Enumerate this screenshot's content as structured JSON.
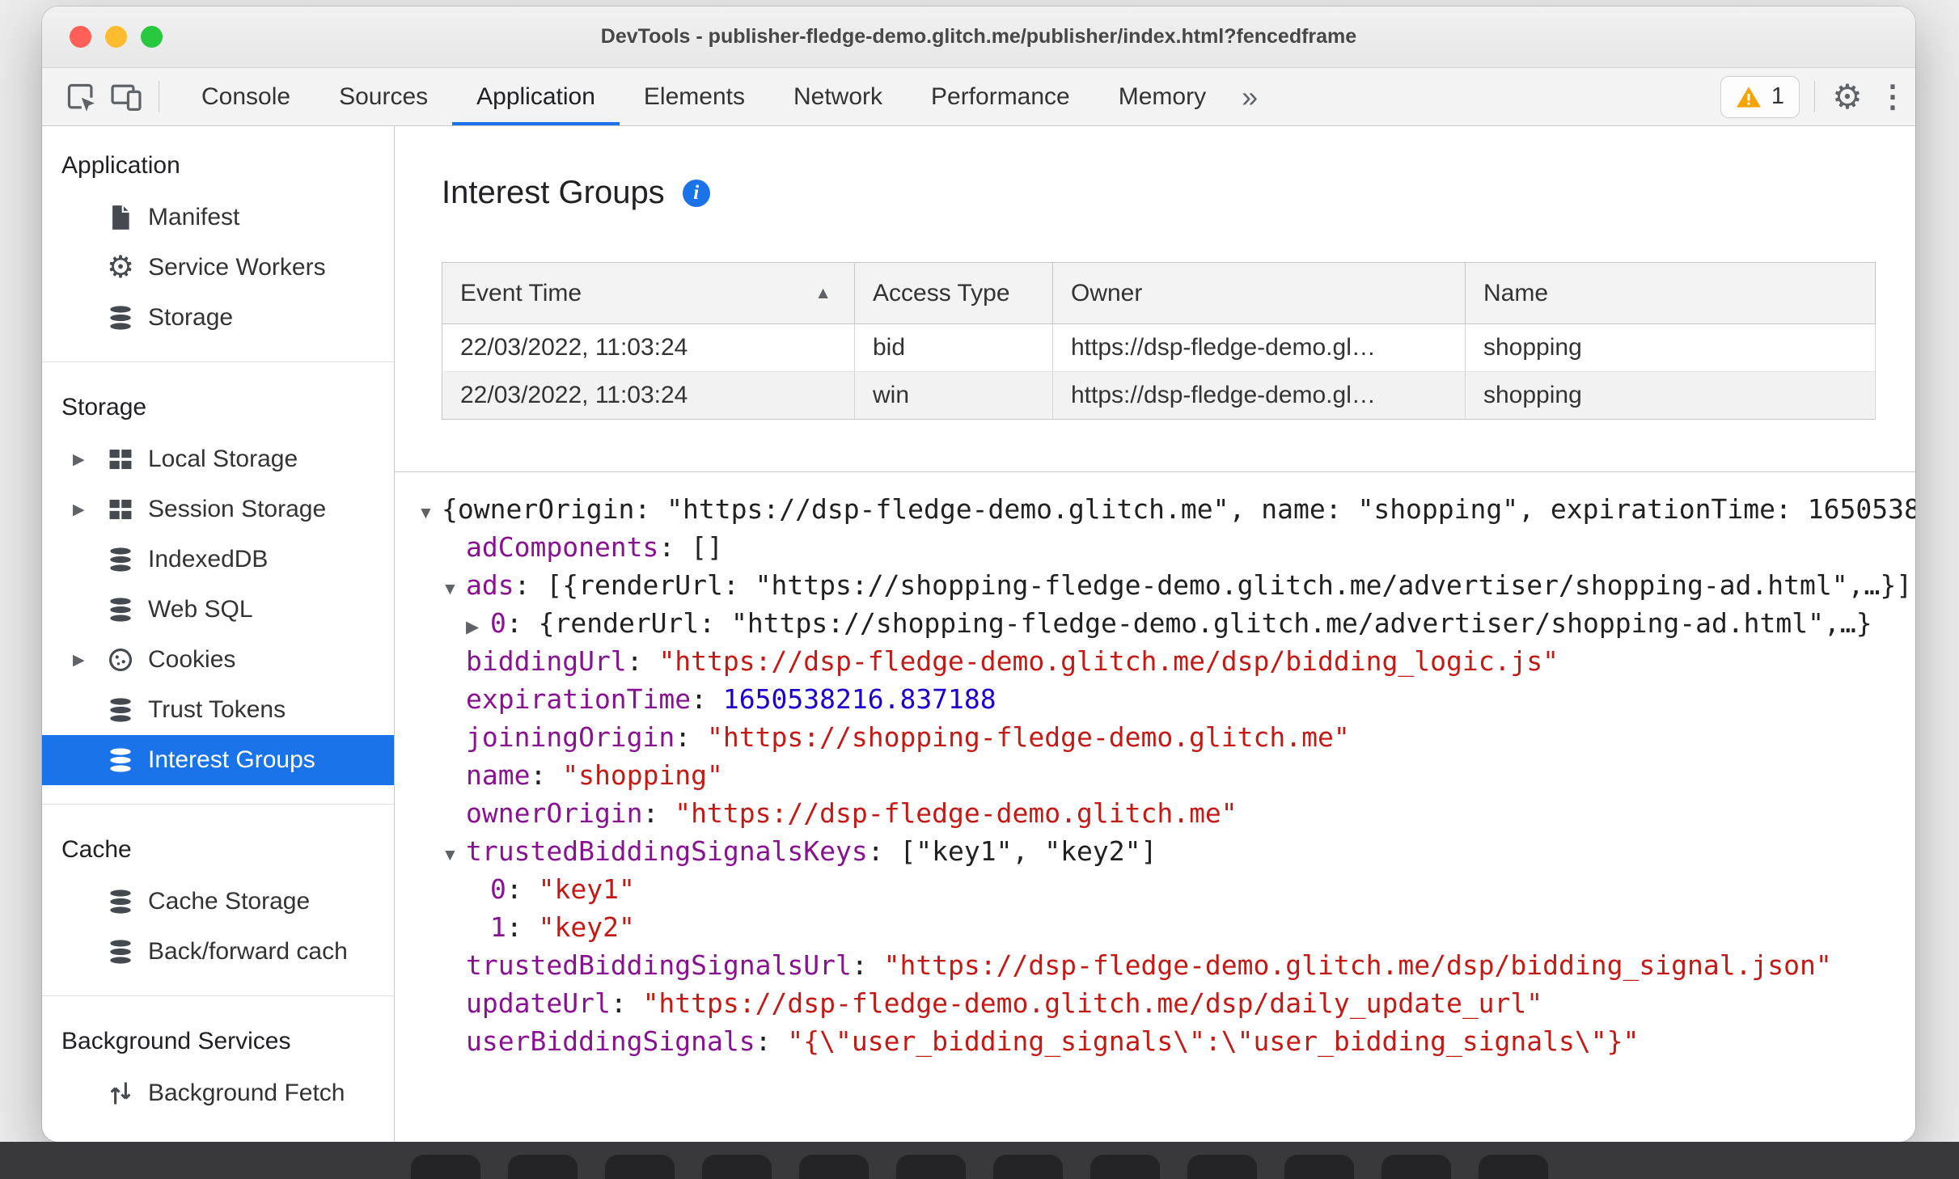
{
  "window": {
    "title": "DevTools - publisher-fledge-demo.glitch.me/publisher/index.html?fencedframe"
  },
  "toolbar": {
    "tabs": [
      {
        "label": "Console",
        "active": false
      },
      {
        "label": "Sources",
        "active": false
      },
      {
        "label": "Application",
        "active": true
      },
      {
        "label": "Elements",
        "active": false
      },
      {
        "label": "Network",
        "active": false
      },
      {
        "label": "Performance",
        "active": false
      },
      {
        "label": "Memory",
        "active": false
      }
    ],
    "warning_count": "1"
  },
  "icons": {
    "gear": "⚙",
    "kebab": "⋮",
    "more_tabs": "»",
    "info": "i",
    "sort_ascending": "▲",
    "arrow_expanded": "▼",
    "arrow_collapsed": "▶",
    "sidebar_expander": "▶"
  },
  "colors": {
    "accent_blue": "#1a73e8",
    "selected_row_blue": "#1a73e8",
    "key_purple": "#881391",
    "string_red": "#c41a16",
    "number_blue": "#1c00cf",
    "warning_orange": "#f5a300"
  },
  "sidebar": {
    "sections": [
      {
        "title": "Application",
        "items": [
          {
            "label": "Manifest",
            "icon": "manifest-file-icon",
            "expander": false,
            "selected": false
          },
          {
            "label": "Service Workers",
            "icon": "service-worker-gear-icon",
            "expander": false,
            "selected": false
          },
          {
            "label": "Storage",
            "icon": "storage-stack-icon",
            "expander": false,
            "selected": false
          }
        ]
      },
      {
        "title": "Storage",
        "items": [
          {
            "label": "Local Storage",
            "icon": "datagrid-icon",
            "expander": true,
            "selected": false
          },
          {
            "label": "Session Storage",
            "icon": "datagrid-icon",
            "expander": true,
            "selected": false
          },
          {
            "label": "IndexedDB",
            "icon": "storage-stack-icon",
            "expander": false,
            "selected": false
          },
          {
            "label": "Web SQL",
            "icon": "storage-stack-icon",
            "expander": false,
            "selected": false
          },
          {
            "label": "Cookies",
            "icon": "cookie-icon",
            "expander": true,
            "selected": false
          },
          {
            "label": "Trust Tokens",
            "icon": "storage-stack-icon",
            "expander": false,
            "selected": false
          },
          {
            "label": "Interest Groups",
            "icon": "storage-stack-icon",
            "expander": false,
            "selected": true
          }
        ]
      },
      {
        "title": "Cache",
        "items": [
          {
            "label": "Cache Storage",
            "icon": "storage-stack-icon",
            "expander": false,
            "selected": false
          },
          {
            "label": "Back/forward cach",
            "icon": "storage-stack-icon",
            "expander": false,
            "selected": false
          }
        ]
      },
      {
        "title": "Background Services",
        "items": [
          {
            "label": "Background Fetch",
            "icon": "fetch-arrows-icon",
            "expander": false,
            "selected": false
          }
        ]
      }
    ]
  },
  "main": {
    "title": "Interest Groups",
    "table": {
      "columns": [
        "Event Time",
        "Access Type",
        "Owner",
        "Name"
      ],
      "sort_column": "Event Time",
      "sort_direction": "ascending",
      "rows": [
        [
          "22/03/2022, 11:03:24",
          "bid",
          "https://dsp-fledge-demo.gl…",
          "shopping"
        ],
        [
          "22/03/2022, 11:03:24",
          "win",
          "https://dsp-fledge-demo.gl…",
          "shopping"
        ]
      ]
    },
    "tree": [
      {
        "indent": 0,
        "arrow": "expanded",
        "tokens": [
          {
            "c": "plain",
            "t": "{ownerOrigin: \"https://dsp-fledge-demo.glitch.me\", name: \"shopping\", expirationTime: 1650538"
          }
        ]
      },
      {
        "indent": 1,
        "arrow": null,
        "tokens": [
          {
            "c": "key",
            "t": "adComponents"
          },
          {
            "c": "plain",
            "t": ": []"
          }
        ]
      },
      {
        "indent": 1,
        "arrow": "expanded",
        "tokens": [
          {
            "c": "key",
            "t": "ads"
          },
          {
            "c": "plain",
            "t": ": [{renderUrl: \"https://shopping-fledge-demo.glitch.me/advertiser/shopping-ad.html\",…}]"
          }
        ]
      },
      {
        "indent": 2,
        "arrow": "collapsed",
        "tokens": [
          {
            "c": "key",
            "t": "0"
          },
          {
            "c": "plain",
            "t": ": {renderUrl: \"https://shopping-fledge-demo.glitch.me/advertiser/shopping-ad.html\",…}"
          }
        ]
      },
      {
        "indent": 1,
        "arrow": null,
        "tokens": [
          {
            "c": "key",
            "t": "biddingUrl"
          },
          {
            "c": "plain",
            "t": ": "
          },
          {
            "c": "string",
            "t": "\"https://dsp-fledge-demo.glitch.me/dsp/bidding_logic.js\""
          }
        ]
      },
      {
        "indent": 1,
        "arrow": null,
        "tokens": [
          {
            "c": "key",
            "t": "expirationTime"
          },
          {
            "c": "plain",
            "t": ": "
          },
          {
            "c": "number",
            "t": "1650538216.837188"
          }
        ]
      },
      {
        "indent": 1,
        "arrow": null,
        "tokens": [
          {
            "c": "key",
            "t": "joiningOrigin"
          },
          {
            "c": "plain",
            "t": ": "
          },
          {
            "c": "string",
            "t": "\"https://shopping-fledge-demo.glitch.me\""
          }
        ]
      },
      {
        "indent": 1,
        "arrow": null,
        "tokens": [
          {
            "c": "key",
            "t": "name"
          },
          {
            "c": "plain",
            "t": ": "
          },
          {
            "c": "string",
            "t": "\"shopping\""
          }
        ]
      },
      {
        "indent": 1,
        "arrow": null,
        "tokens": [
          {
            "c": "key",
            "t": "ownerOrigin"
          },
          {
            "c": "plain",
            "t": ": "
          },
          {
            "c": "string",
            "t": "\"https://dsp-fledge-demo.glitch.me\""
          }
        ]
      },
      {
        "indent": 1,
        "arrow": "expanded",
        "tokens": [
          {
            "c": "key",
            "t": "trustedBiddingSignalsKeys"
          },
          {
            "c": "plain",
            "t": ": [\"key1\", \"key2\"]"
          }
        ]
      },
      {
        "indent": 2,
        "arrow": null,
        "tokens": [
          {
            "c": "key",
            "t": "0"
          },
          {
            "c": "plain",
            "t": ": "
          },
          {
            "c": "string",
            "t": "\"key1\""
          }
        ]
      },
      {
        "indent": 2,
        "arrow": null,
        "tokens": [
          {
            "c": "key",
            "t": "1"
          },
          {
            "c": "plain",
            "t": ": "
          },
          {
            "c": "string",
            "t": "\"key2\""
          }
        ]
      },
      {
        "indent": 1,
        "arrow": null,
        "tokens": [
          {
            "c": "key",
            "t": "trustedBiddingSignalsUrl"
          },
          {
            "c": "plain",
            "t": ": "
          },
          {
            "c": "string",
            "t": "\"https://dsp-fledge-demo.glitch.me/dsp/bidding_signal.json\""
          }
        ]
      },
      {
        "indent": 1,
        "arrow": null,
        "tokens": [
          {
            "c": "key",
            "t": "updateUrl"
          },
          {
            "c": "plain",
            "t": ": "
          },
          {
            "c": "string",
            "t": "\"https://dsp-fledge-demo.glitch.me/dsp/daily_update_url\""
          }
        ]
      },
      {
        "indent": 1,
        "arrow": null,
        "tokens": [
          {
            "c": "key",
            "t": "userBiddingSignals"
          },
          {
            "c": "plain",
            "t": ": "
          },
          {
            "c": "string",
            "t": "\"{\\\"user_bidding_signals\\\":\\\"user_bidding_signals\\\"}\""
          }
        ]
      }
    ]
  }
}
